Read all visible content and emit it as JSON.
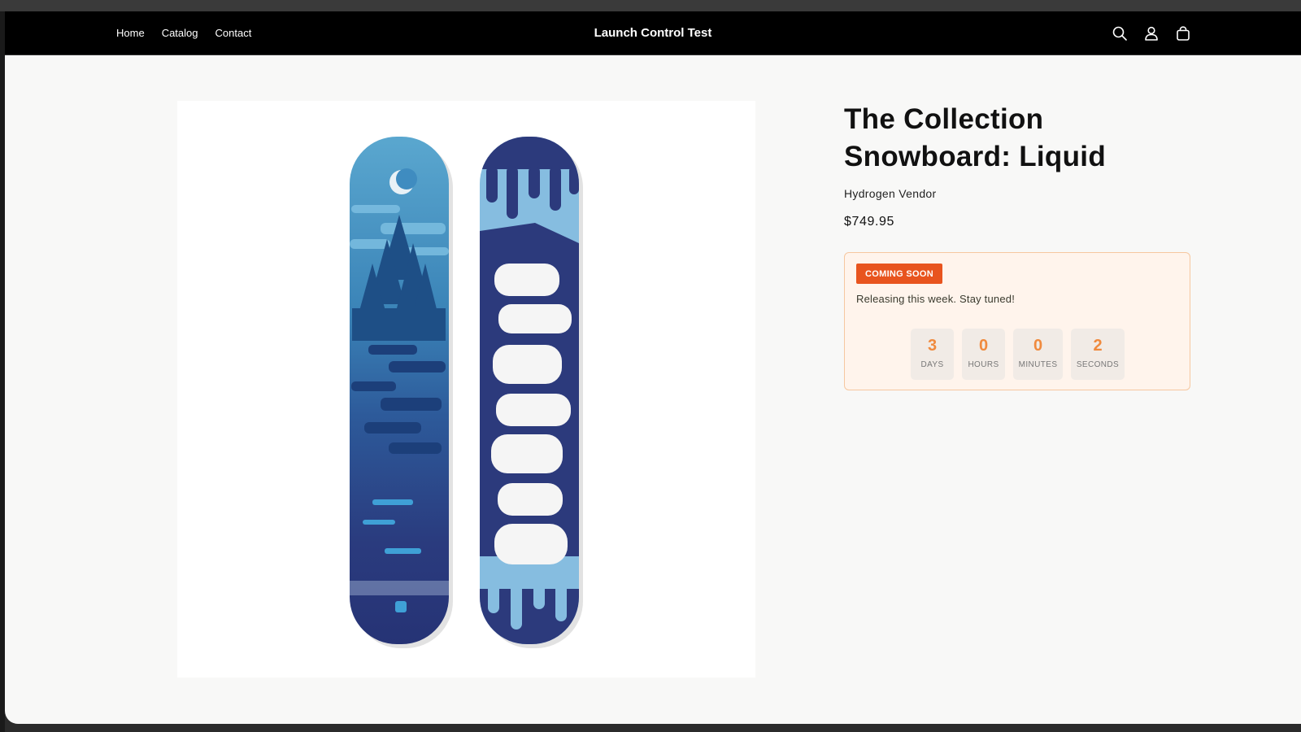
{
  "nav": {
    "links": [
      "Home",
      "Catalog",
      "Contact"
    ],
    "store_title": "Launch Control Test",
    "icons": [
      "search-icon",
      "account-icon",
      "cart-icon"
    ]
  },
  "product": {
    "title": "The Collection Snowboard: Liquid",
    "vendor": "Hydrogen Vendor",
    "price": "$749.95"
  },
  "launch": {
    "badge": "COMING SOON",
    "message": "Releasing this week. Stay tuned!",
    "countdown": [
      {
        "value": "3",
        "label": "DAYS"
      },
      {
        "value": "0",
        "label": "HOURS"
      },
      {
        "value": "0",
        "label": "MINUTES"
      },
      {
        "value": "2",
        "label": "SECONDS"
      }
    ]
  },
  "colors": {
    "nav_bg": "#000000",
    "badge": "#e8541e",
    "countdown_digit": "#f08a3e",
    "launch_box_bg": "#fff4ec"
  }
}
